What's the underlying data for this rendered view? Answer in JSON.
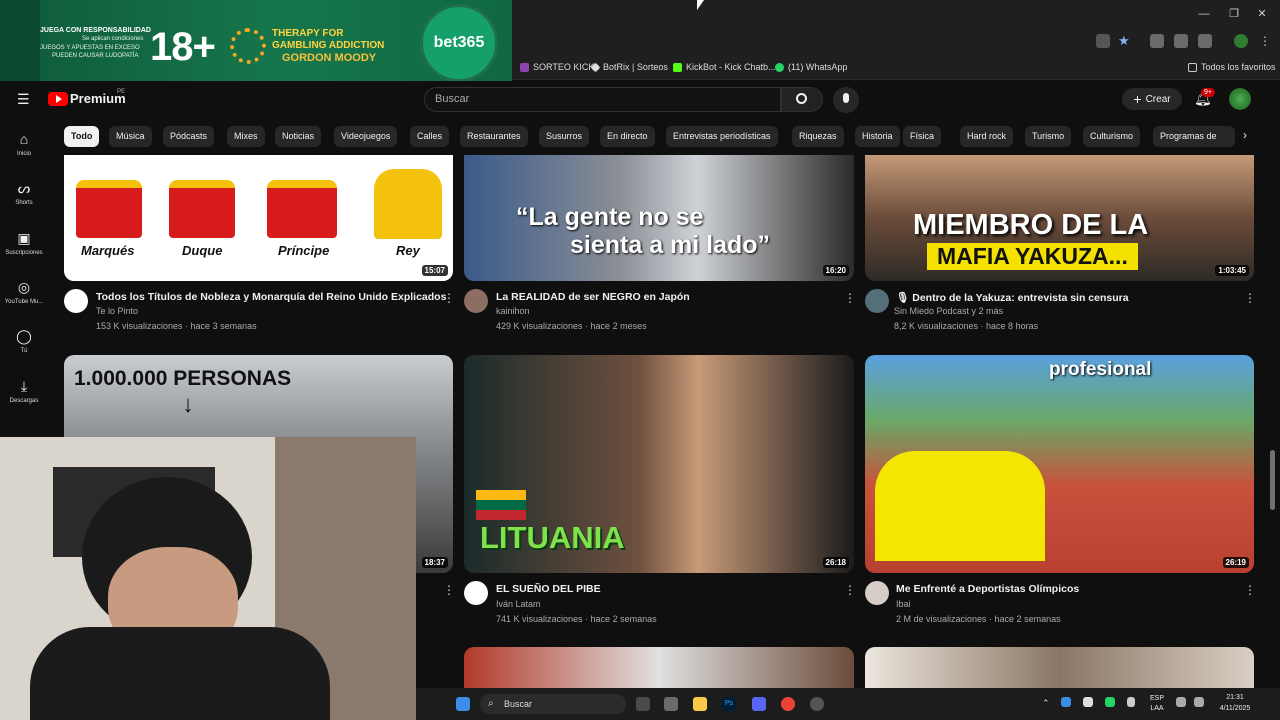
{
  "ad": {
    "responsible": "JUEGA CON RESPONSABILIDAD",
    "conditions": "Se aplican condiciones",
    "warning1": "JUEGOS Y APUESTAS EN EXCESO",
    "warning2": "PUEDEN CAUSAR LUDOPATÍA",
    "age": "18+",
    "therapy1": "THERAPY FOR",
    "therapy2": "GAMBLING ADDICTION",
    "gordon": "GORDON MOODY",
    "brand": "bet365"
  },
  "bookmarks": [
    {
      "label": "SORTEO KICK",
      "color": "#8e44ad"
    },
    {
      "label": "BotRix | Sorteos",
      "color": "#dddddd"
    },
    {
      "label": "KickBot - Kick Chatb...",
      "color": "#53fc18"
    },
    {
      "label": "(11) WhatsApp",
      "color": "#25d366"
    }
  ],
  "bookmarks_right": "Todos los favoritos",
  "youtube": {
    "brand": "Premium",
    "region": "PE",
    "search_placeholder": "Buscar",
    "create_label": "Crear",
    "notif_count": "9+"
  },
  "chips": [
    "Todo",
    "Música",
    "Pódcasts",
    "Mixes",
    "Noticias",
    "Videojuegos",
    "Calles",
    "Restaurantes",
    "Susurros",
    "En directo",
    "Entrevistas periodísticas",
    "Riquezas",
    "Historia",
    "Física",
    "Hard rock",
    "Turismo",
    "Culturismo",
    "Programas de"
  ],
  "sidebar": [
    {
      "label": "Inicio",
      "icon": "home-icon"
    },
    {
      "label": "Shorts",
      "icon": "shorts-icon"
    },
    {
      "label": "Suscripciones",
      "icon": "subscriptions-icon"
    },
    {
      "label": "YouTube Mu...",
      "icon": "music-icon"
    },
    {
      "label": "Tú",
      "icon": "user-icon"
    },
    {
      "label": "Descargas",
      "icon": "download-icon"
    }
  ],
  "videos": [
    {
      "title": "Todos los Títulos de Nobleza y Monarquía del Reino Unido Explicados",
      "channel": "Te lo Pinto",
      "meta": "153 K visualizaciones · hace 3 semanas",
      "duration": "15:07"
    },
    {
      "title": "La REALIDAD de ser NEGRO en Japón",
      "channel": "kainihon",
      "meta": "429 K visualizaciones · hace 2 meses",
      "duration": "16:20"
    },
    {
      "title": "🎙 Dentro de la Yakuza: entrevista sin censura",
      "channel": "Sin Miedo Podcast y 2 más",
      "meta": "8,2 K visualizaciones · hace 8 horas",
      "duration": "1:03:45"
    },
    {
      "title": "",
      "channel": "",
      "meta": "",
      "duration": "18:37"
    },
    {
      "title": "EL SUEÑO DEL PIBE",
      "channel": "Iván Latam",
      "meta": "741 K visualizaciones · hace 2 semanas",
      "duration": "26:18"
    },
    {
      "title": "Me Enfrenté a Deportistas Olímpicos",
      "channel": "Ibai",
      "meta": "2 M de visualizaciones · hace 2 semanas",
      "duration": "26:19"
    }
  ],
  "thumb_text": {
    "crown1": "Marqués",
    "crown2": "Duque",
    "crown3": "Príncipe",
    "crown4": "Rey",
    "japan1": "“La gente no se",
    "japan2": "sienta a mi lado”",
    "yakuza1": "MIEMBRO DE LA",
    "yakuza2": "MAFIA YAKUZA...",
    "million": "1.000.000 PERSONAS",
    "lituania": "LITUANIA",
    "profesional": "profesional"
  },
  "taskbar": {
    "search": "Buscar",
    "lang1": "ESP",
    "lang2": "LAA",
    "time": "21:31",
    "date": "4/11/2025"
  },
  "colors": {
    "accent": "#ff0000",
    "bg": "#0f0f0f",
    "chip": "#272727",
    "ad_green": "#16764b"
  }
}
